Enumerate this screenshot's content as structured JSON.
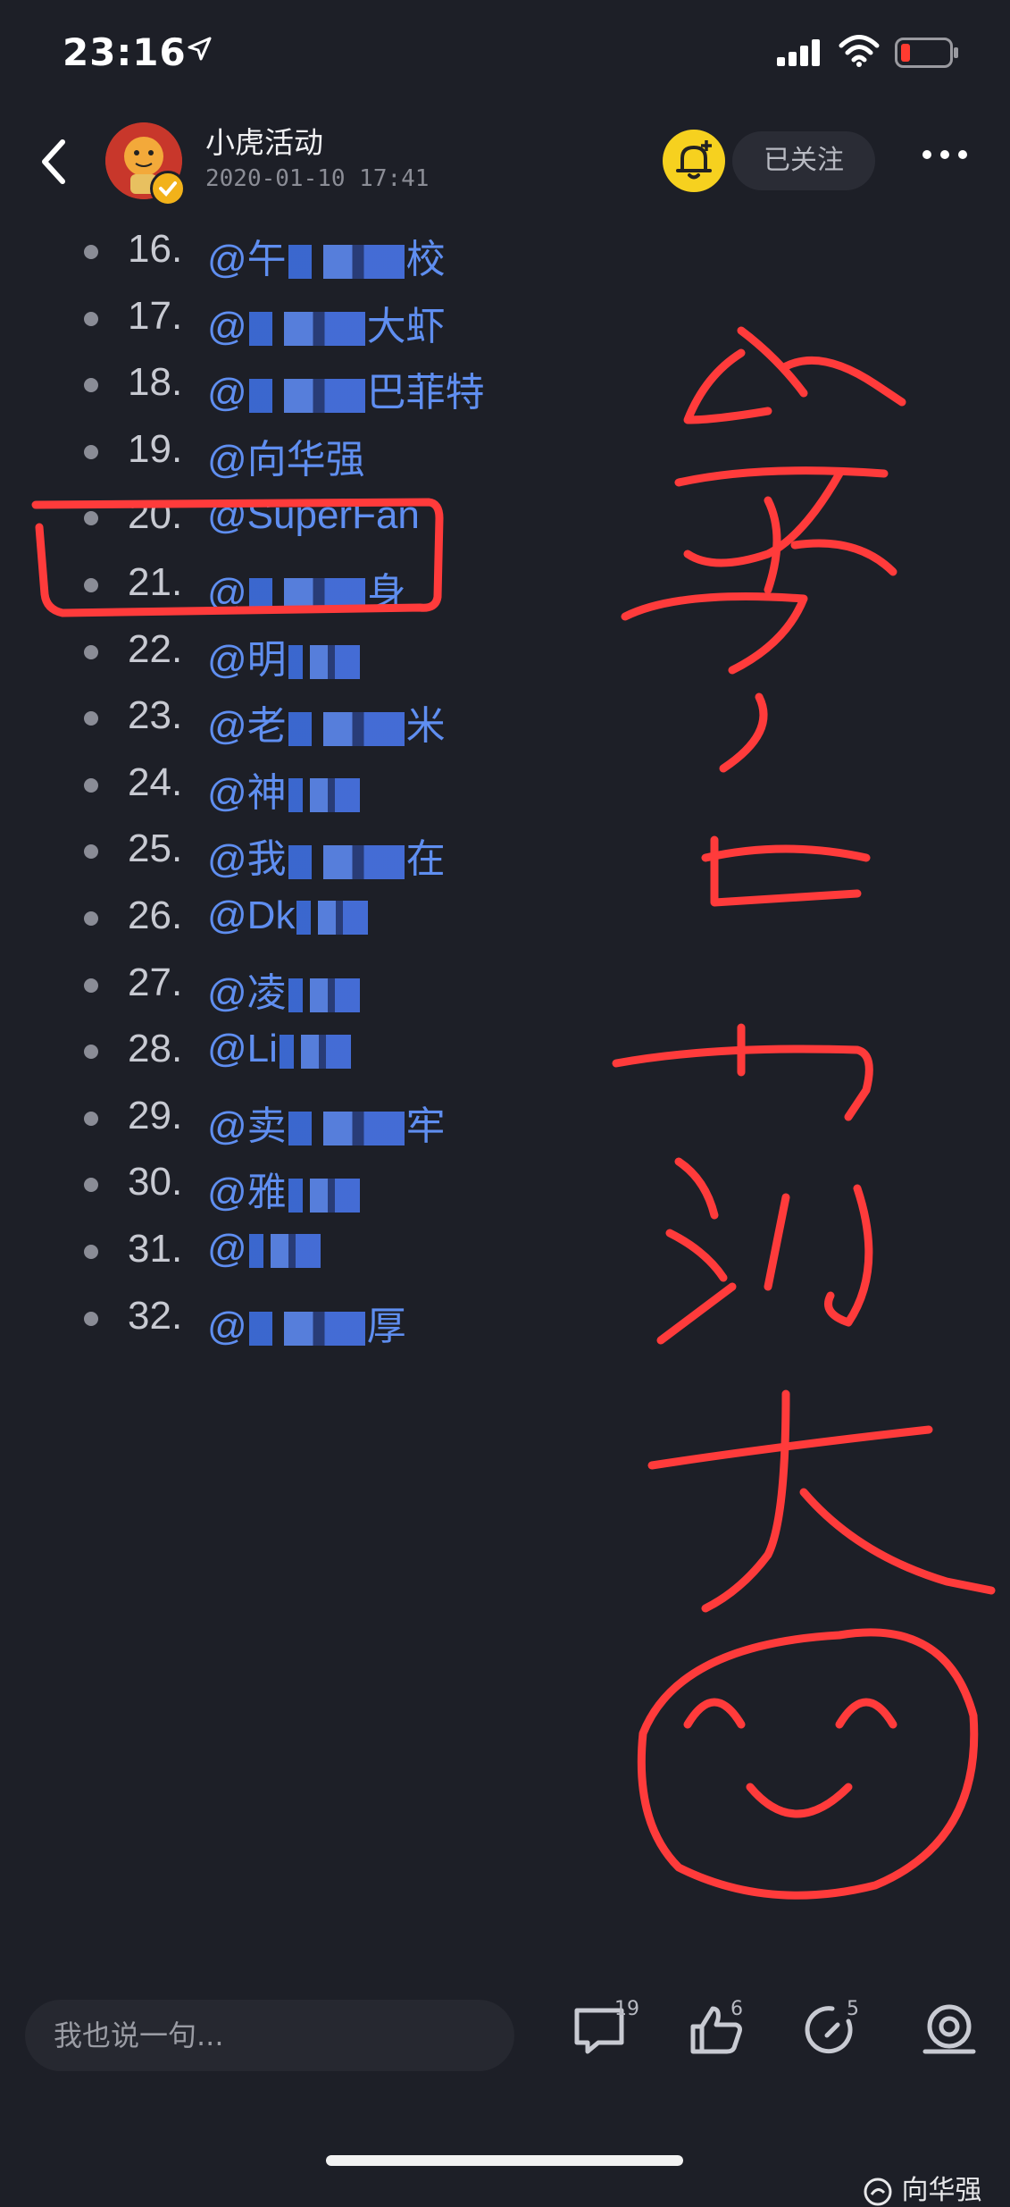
{
  "status": {
    "time": "23:16"
  },
  "header": {
    "author_name": "小虎活动",
    "post_time": "2020-01-10 17:41",
    "follow_label": "已关注"
  },
  "list": [
    {
      "num": "16.",
      "visible": "@午",
      "tail": "校"
    },
    {
      "num": "17.",
      "visible": "@",
      "tail": "大虾"
    },
    {
      "num": "18.",
      "visible": "@",
      "tail": "巴菲特"
    },
    {
      "num": "19.",
      "visible": "@向华强",
      "tail": ""
    },
    {
      "num": "20.",
      "visible": "@SuperFan",
      "tail": ""
    },
    {
      "num": "21.",
      "visible": "@",
      "tail": "身"
    },
    {
      "num": "22.",
      "visible": "@明",
      "tail": ""
    },
    {
      "num": "23.",
      "visible": "@老",
      "tail": "米"
    },
    {
      "num": "24.",
      "visible": "@神",
      "tail": ""
    },
    {
      "num": "25.",
      "visible": "@我",
      "tail": "在"
    },
    {
      "num": "26.",
      "visible": "@Dk",
      "tail": ""
    },
    {
      "num": "27.",
      "visible": "@凌",
      "tail": ""
    },
    {
      "num": "28.",
      "visible": "@Li",
      "tail": ""
    },
    {
      "num": "29.",
      "visible": "@卖",
      "tail": "牢"
    },
    {
      "num": "30.",
      "visible": "@雅",
      "tail": ""
    },
    {
      "num": "31.",
      "visible": "@",
      "tail": ""
    },
    {
      "num": "32.",
      "visible": "@",
      "tail": "厚"
    }
  ],
  "bottom": {
    "comment_placeholder": "我也说一句...",
    "comments_count": "19",
    "likes_count": "6",
    "shares_count": "5"
  },
  "watermark": "向华强",
  "colors": {
    "background": "#1d1f27",
    "link": "#5f8ef0",
    "annotation": "#ff3b3b",
    "bell": "#f6d11f"
  }
}
